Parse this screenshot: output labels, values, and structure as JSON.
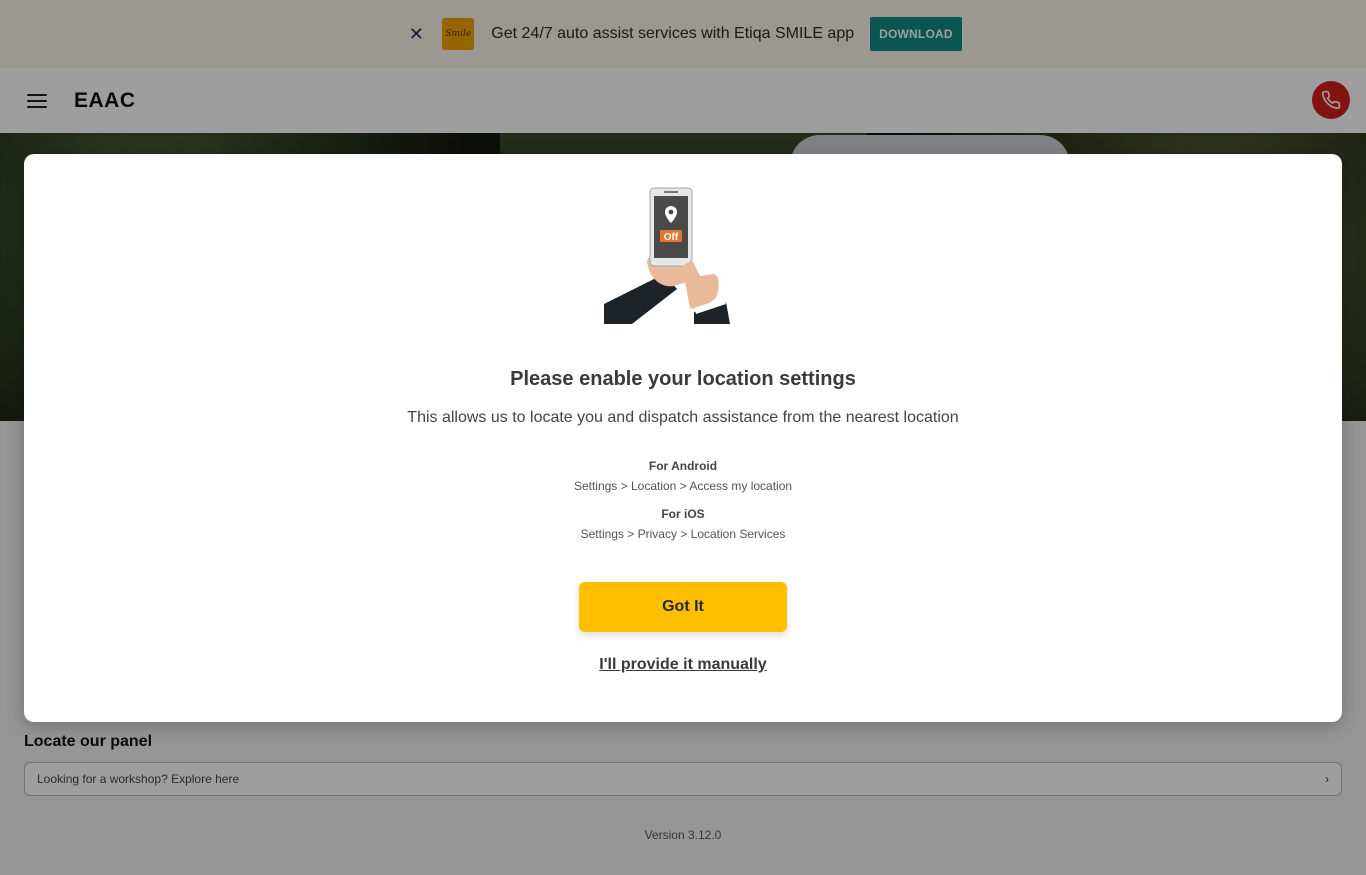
{
  "promo": {
    "close_icon": "close-icon",
    "logo_text": "Smile",
    "message": "Get 24/7 auto assist services with Etiqa SMILE app",
    "download_label": "DOWNLOAD",
    "accent": "#0f8a84"
  },
  "header": {
    "menu_icon": "hamburger-icon",
    "brand": "EAAC",
    "call_icon": "phone-icon",
    "call_color": "#d21f1f"
  },
  "page": {
    "locate_title": "Locate our panel",
    "locate_placeholder": "Looking for a workshop? Explore here",
    "version": "Version 3.12.0"
  },
  "modal": {
    "illustration_badge": "Off",
    "title": "Please enable your location settings",
    "subtitle": "This allows us to locate you and dispatch assistance from the nearest location",
    "android_heading": "For Android",
    "android_steps": "Settings > Location > Access my location",
    "ios_heading": "For iOS",
    "ios_steps": "Settings > Privacy > Location Services",
    "primary_button": "Got It",
    "primary_color": "#ffbf00",
    "secondary_link": "I'll provide it manually"
  }
}
